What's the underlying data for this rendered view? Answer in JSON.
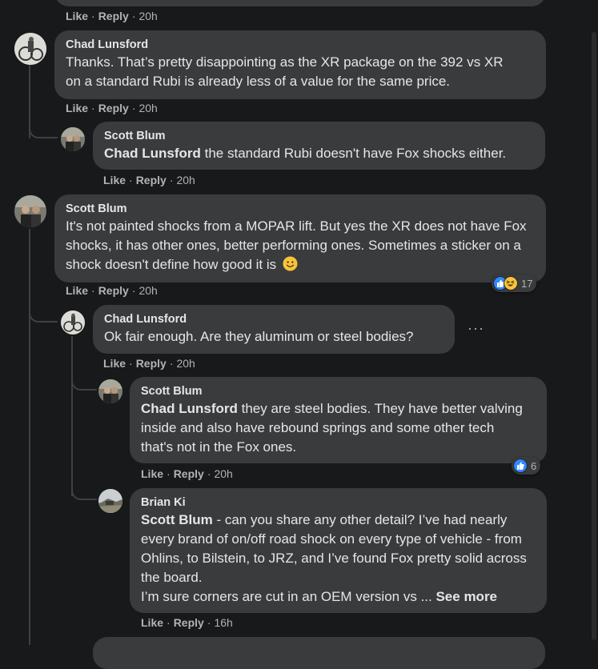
{
  "top_comment": {
    "actions": {
      "like": "Like",
      "reply": "Reply",
      "time": "20h"
    }
  },
  "comment1": {
    "author": "Chad Lunsford",
    "text": "Thanks. That’s pretty disappointing as the XR package on the 392 vs XR on a standard Rubi is already less of a value for the same price.",
    "actions": {
      "like": "Like",
      "reply": "Reply",
      "time": "20h"
    }
  },
  "reply1": {
    "author": "Scott Blum",
    "mention": "Chad Lunsford",
    "text": " the standard Rubi doesn't have Fox shocks either.",
    "actions": {
      "like": "Like",
      "reply": "Reply",
      "time": "20h"
    }
  },
  "comment2": {
    "author": "Scott Blum",
    "text": "It's not painted shocks from a MOPAR lift. But yes the XR does not have Fox shocks, it has other ones, better performing ones. Sometimes a sticker on a shock doesn't define how good it is",
    "emoji": "smile-emoji",
    "actions": {
      "like": "Like",
      "reply": "Reply",
      "time": "20h"
    },
    "reactions": {
      "count": "17",
      "icons": [
        "like-icon",
        "haha-icon"
      ]
    }
  },
  "reply2": {
    "author": "Chad Lunsford",
    "text": "Ok fair enough. Are they aluminum or steel bodies?",
    "more": "···",
    "actions": {
      "like": "Like",
      "reply": "Reply",
      "time": "20h"
    }
  },
  "reply3": {
    "author": "Scott Blum",
    "mention": "Chad Lunsford",
    "text": " they are steel bodies. They have better valving inside and also have rebound springs and some other tech that's not in the Fox ones.",
    "actions": {
      "like": "Like",
      "reply": "Reply",
      "time": "20h"
    },
    "reactions": {
      "count": "6",
      "icons": [
        "like-icon"
      ]
    }
  },
  "reply4": {
    "author": "Brian Ki",
    "mention": "Scott Blum",
    "text": " - can you share any other detail? I’ve had nearly every brand of on/off road shock on every type of vehicle - from Ohlins, to Bilstein, to JRZ, and I’ve found Fox pretty solid across the board.",
    "text2": "I’m sure corners are cut in an OEM version vs ... ",
    "see_more": "See more",
    "actions": {
      "like": "Like",
      "reply": "Reply",
      "time": "16h"
    }
  },
  "colors": {
    "background": "#18191a",
    "bubble": "#3a3b3c",
    "like_blue": "#2d88ff",
    "secondary_text": "#b0b3b8"
  }
}
